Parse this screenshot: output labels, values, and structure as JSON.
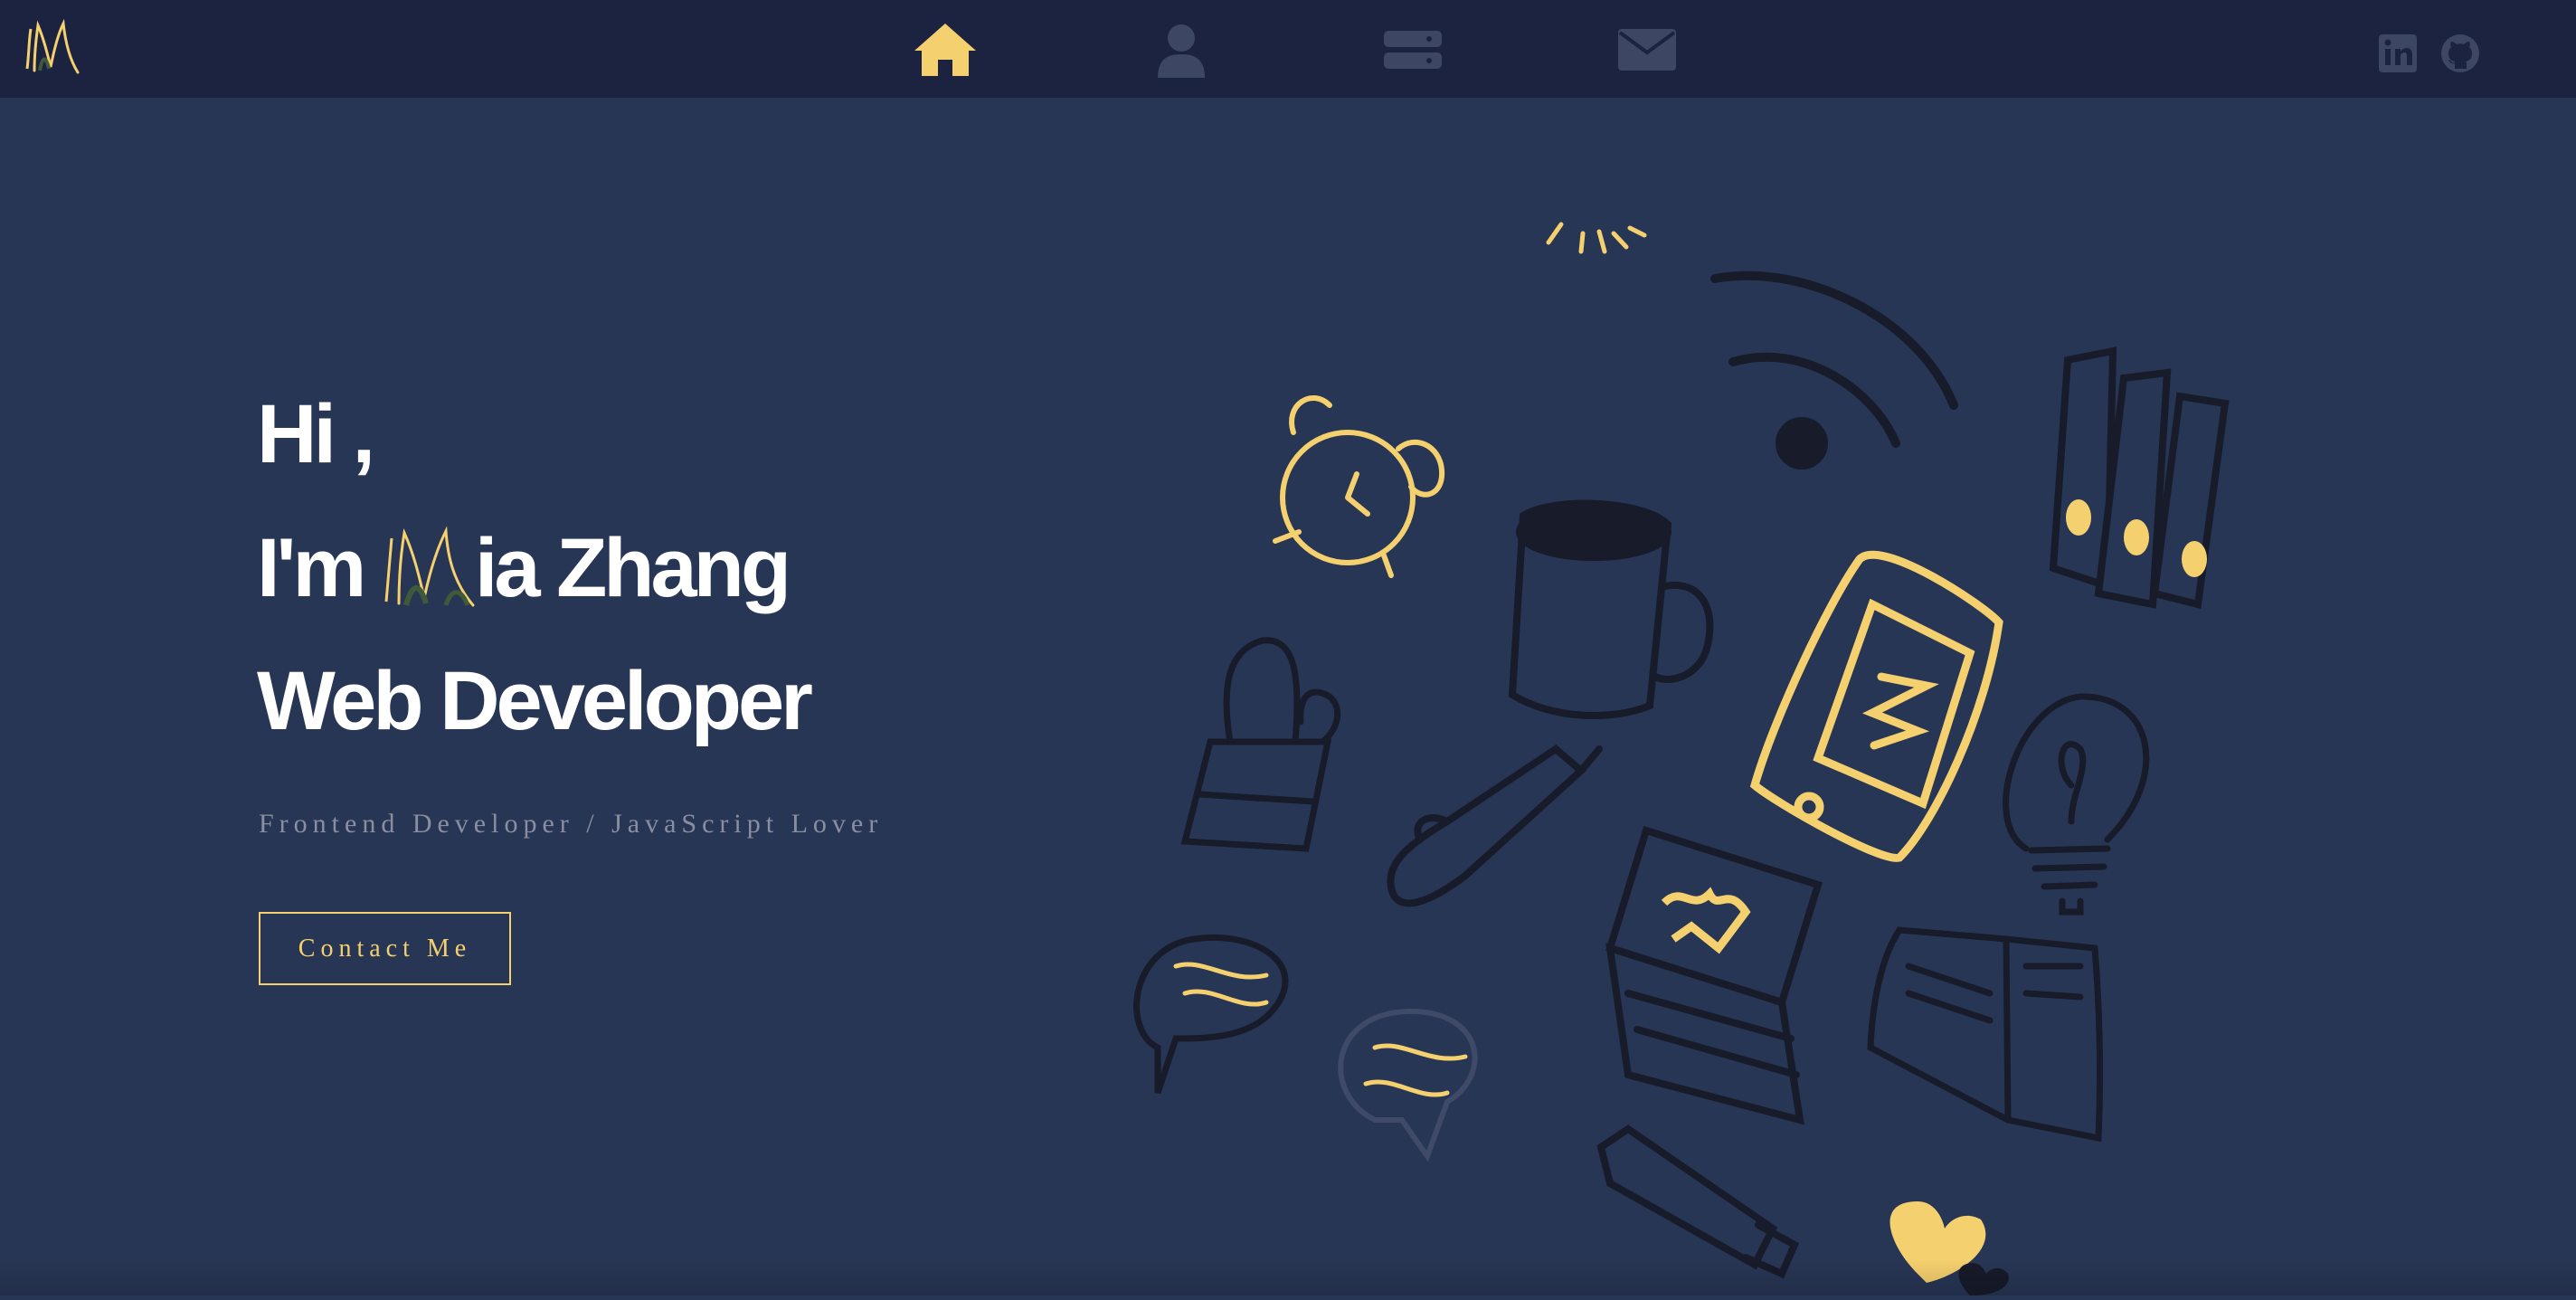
{
  "nav": {
    "items": [
      {
        "icon": "home-icon",
        "label": "Home",
        "active": true
      },
      {
        "icon": "user-icon",
        "label": "About",
        "active": false
      },
      {
        "icon": "server-icon",
        "label": "Projects",
        "active": false
      },
      {
        "icon": "envelope-icon",
        "label": "Contact",
        "active": false
      }
    ],
    "social": [
      {
        "icon": "linkedin-icon"
      },
      {
        "icon": "github-icon"
      }
    ]
  },
  "hero": {
    "greeting": "Hi ,",
    "intro_prefix": "I'm ",
    "name_rest": "ia Zhang",
    "role": "Web Developer",
    "subtitle": "Frontend Developer / JavaScript Lover",
    "contact_label": "Contact Me"
  },
  "colors": {
    "nav_bg": "#1c2341",
    "page_bg": "#283655",
    "accent": "#f5d06f",
    "muted_icon": "#3d4663",
    "text": "#ffffff"
  }
}
